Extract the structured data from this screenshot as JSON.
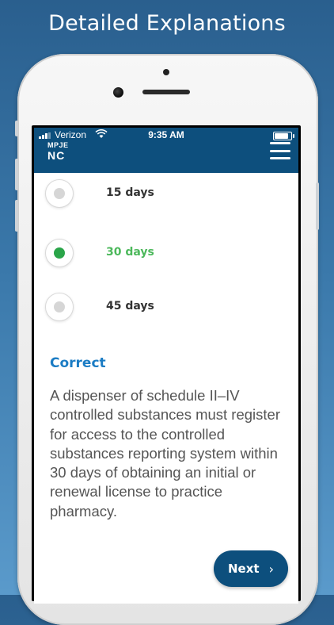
{
  "caption": "Detailed Explanations",
  "status_bar": {
    "carrier": "Verizon",
    "time": "9:35 AM",
    "battery_level": 0.95
  },
  "app": {
    "logo_top": "MPJE",
    "logo_bottom": "NC",
    "menu_icon": "hamburger-menu-icon"
  },
  "options": [
    {
      "label": "15 days",
      "selected": false
    },
    {
      "label": "30 days",
      "selected": true
    },
    {
      "label": "45 days",
      "selected": false
    }
  ],
  "result": {
    "label": "Correct",
    "color": "#1b7cc4"
  },
  "explanation": "A dispenser of schedule II–IV controlled substances must register for access to the controlled substances reporting system within 30 days of obtaining an initial or renewal license to practice pharmacy.",
  "next_button": {
    "label": "Next",
    "icon": "chevron-right-icon"
  },
  "colors": {
    "primary": "#0d4f7d",
    "correct": "#4cb85b",
    "radio_selected": "#2aa549"
  }
}
